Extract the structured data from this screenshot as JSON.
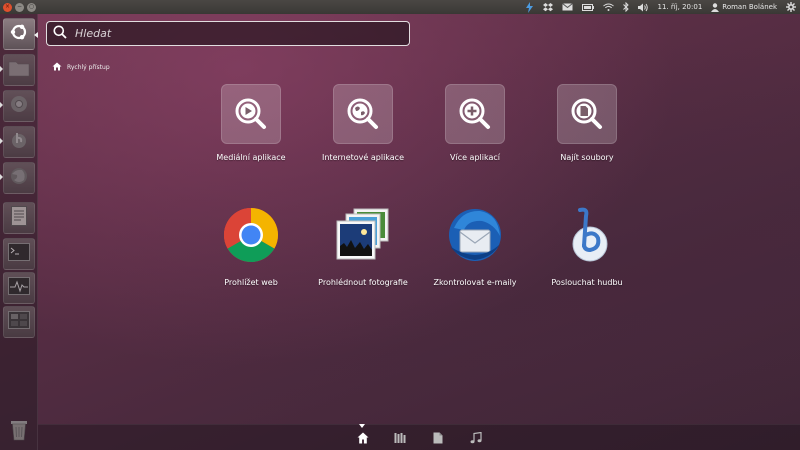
{
  "top_panel": {
    "clock": "11. říj, 20:01",
    "user_name": "Roman Bolánek"
  },
  "launcher": {
    "items": [
      {
        "icon": "ubuntu-dash-icon"
      },
      {
        "icon": "home-folder-icon"
      },
      {
        "icon": "chromium-icon"
      },
      {
        "icon": "banshee-icon"
      },
      {
        "icon": "firefox-icon"
      },
      {
        "icon": "text-editor-icon"
      },
      {
        "icon": "terminal-icon"
      },
      {
        "icon": "system-monitor-icon"
      },
      {
        "icon": "workspace-switcher-icon"
      },
      {
        "icon": "trash-icon"
      }
    ]
  },
  "search": {
    "placeholder": "Hledat"
  },
  "breadcrumb": {
    "label": "Rychlý přístup"
  },
  "shortcuts": {
    "media_apps": "Mediální aplikace",
    "internet_apps": "Internetové aplikace",
    "more_apps": "Více aplikací",
    "find_files": "Najít soubory",
    "browse_web": "Prohlížet web",
    "view_photos": "Prohlédnout fotografie",
    "check_email": "Zkontrolovat e-maily",
    "listen_music": "Poslouchat hudbu"
  },
  "lenses": [
    {
      "icon": "home-lens-icon",
      "active": true
    },
    {
      "icon": "applications-lens-icon",
      "active": false
    },
    {
      "icon": "files-lens-icon",
      "active": false
    },
    {
      "icon": "music-lens-icon",
      "active": false
    }
  ],
  "colors": {
    "accent": "#dd4814",
    "close_button": "#e0502d"
  }
}
